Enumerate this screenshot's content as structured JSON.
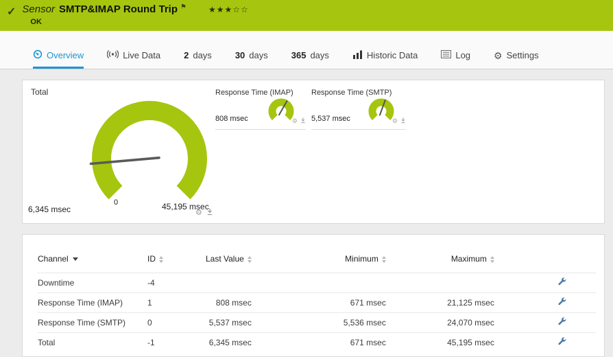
{
  "colors": {
    "accent_green": "#a6c50f",
    "accent_blue": "#1d95d4"
  },
  "icons": {
    "check": "✓",
    "flag": "⚑",
    "gear": "⚙"
  },
  "header": {
    "kind": "Sensor",
    "title": "SMTP&IMAP Round Trip",
    "status": "OK",
    "stars_filled": "★★★",
    "stars_empty": "☆☆"
  },
  "tabs": {
    "overview": {
      "label": "Overview"
    },
    "live_data": {
      "label": "Live Data"
    },
    "days2": {
      "number": "2",
      "label": "days"
    },
    "days30": {
      "number": "30",
      "label": "days"
    },
    "days365": {
      "number": "365",
      "label": "days"
    },
    "historic": {
      "label": "Historic Data"
    },
    "log": {
      "label": "Log"
    },
    "settings": {
      "label": "Settings"
    }
  },
  "gauges": {
    "total": {
      "label": "Total",
      "value": "6,345 msec",
      "scale_min": "0",
      "scale_max": "45,195 msec"
    },
    "imap": {
      "label": "Response Time (IMAP)",
      "value": "808 msec"
    },
    "smtp": {
      "label": "Response Time (SMTP)",
      "value": "5,537 msec"
    }
  },
  "table": {
    "headers": {
      "channel": "Channel",
      "id": "ID",
      "last_value": "Last Value",
      "minimum": "Minimum",
      "maximum": "Maximum"
    },
    "rows": [
      {
        "channel": "Downtime",
        "id": "-4",
        "last_value": "",
        "minimum": "",
        "maximum": ""
      },
      {
        "channel": "Response Time (IMAP)",
        "id": "1",
        "last_value": "808 msec",
        "minimum": "671 msec",
        "maximum": "21,125 msec"
      },
      {
        "channel": "Response Time (SMTP)",
        "id": "0",
        "last_value": "5,537 msec",
        "minimum": "5,536 msec",
        "maximum": "24,070 msec"
      },
      {
        "channel": "Total",
        "id": "-1",
        "last_value": "6,345 msec",
        "minimum": "671 msec",
        "maximum": "45,195 msec"
      }
    ]
  }
}
